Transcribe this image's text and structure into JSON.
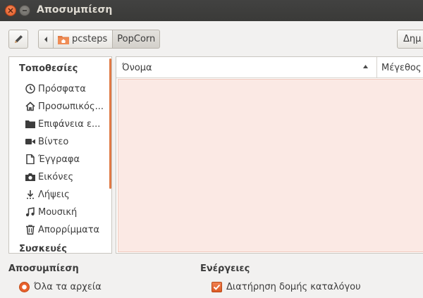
{
  "window": {
    "title": "Αποσυμπίεση"
  },
  "toolbar": {
    "path": [
      {
        "label": "pcsteps",
        "icon": "home-folder-icon"
      },
      {
        "label": "PopCorn"
      }
    ],
    "create_label": "Δημ"
  },
  "sidebar": {
    "places_heading": "Τοποθεσίες",
    "items": [
      {
        "label": "Πρόσφατα",
        "icon": "clock-icon"
      },
      {
        "label": "Προσωπικός...",
        "icon": "home-icon"
      },
      {
        "label": "Επιφάνεια ε...",
        "icon": "folder-icon"
      },
      {
        "label": "Βίντεο",
        "icon": "video-camera-icon"
      },
      {
        "label": "Έγγραφα",
        "icon": "document-icon"
      },
      {
        "label": "Εικόνες",
        "icon": "camera-icon"
      },
      {
        "label": "Λήψεις",
        "icon": "download-icon"
      },
      {
        "label": "Μουσική",
        "icon": "music-note-icon"
      },
      {
        "label": "Απορρίμματα",
        "icon": "trash-icon"
      }
    ],
    "devices_heading": "Συσκευές"
  },
  "filelist": {
    "col_name": "Όνομα",
    "col_size": "Μέγεθος"
  },
  "options": {
    "extract_heading": "Αποσυμπίεση",
    "all_files_label": "Όλα τα αρχεία",
    "actions_heading": "Ενέργειες",
    "keep_structure_label": "Διατήρηση δομής καταλόγου"
  },
  "colors": {
    "accent": "#e8602c",
    "titlebar": "#3c3b37",
    "list_bg": "#fbe9e4"
  }
}
